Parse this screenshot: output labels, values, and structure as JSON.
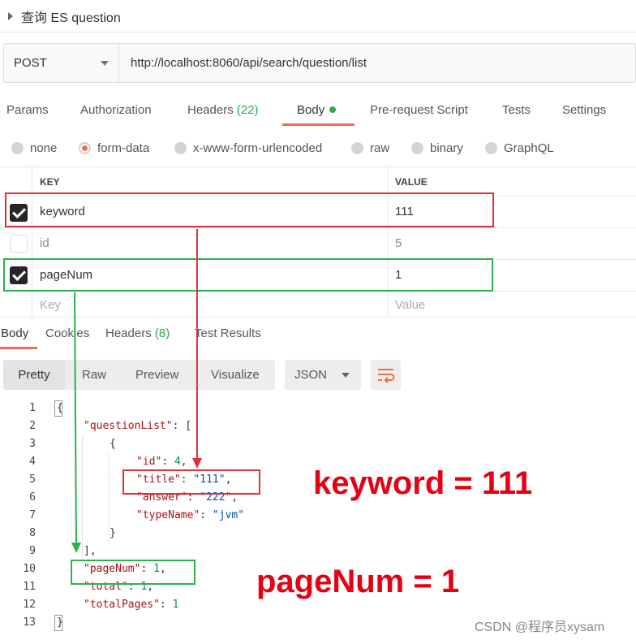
{
  "request": {
    "title": "查询 ES question",
    "method": "POST",
    "url": "http://localhost:8060/api/search/question/list"
  },
  "request_tabs": {
    "params": "Params",
    "authorization": "Authorization",
    "headers": "Headers",
    "headers_count": "(22)",
    "body": "Body",
    "prerequest": "Pre-request Script",
    "tests": "Tests",
    "settings": "Settings"
  },
  "body_types": {
    "none": "none",
    "form_data": "form-data",
    "urlencoded": "x-www-form-urlencoded",
    "raw": "raw",
    "binary": "binary",
    "graphql": "GraphQL"
  },
  "params_table": {
    "key_header": "KEY",
    "value_header": "VALUE",
    "rows": [
      {
        "key": "keyword",
        "value": "111",
        "checked": true
      },
      {
        "key": "id",
        "value": "5",
        "checked": false
      },
      {
        "key": "pageNum",
        "value": "1",
        "checked": true
      }
    ],
    "placeholder_key": "Key",
    "placeholder_value": "Value"
  },
  "response_tabs": {
    "body": "Body",
    "cookies": "Cookies",
    "headers": "Headers",
    "headers_count": "(8)",
    "test_results": "Test Results"
  },
  "response_toolbar": {
    "pretty": "Pretty",
    "raw": "Raw",
    "preview": "Preview",
    "visualize": "Visualize",
    "format": "JSON"
  },
  "code_lines": [
    "1",
    "2",
    "3",
    "4",
    "5",
    "6",
    "7",
    "8",
    "9",
    "10",
    "11",
    "12",
    "13"
  ],
  "json": {
    "k_questionList": "\"questionList\"",
    "k_id": "\"id\"",
    "v_id": "4",
    "k_title": "\"title\"",
    "v_title": "\"111\"",
    "k_answer": "\"answer\"",
    "v_answer": "\"222\"",
    "k_typeName": "\"typeName\"",
    "v_typeName": "\"jvm\"",
    "k_pageNum": "\"pageNum\"",
    "v_pageNum": "1",
    "k_total": "\"total\"",
    "v_total": "1",
    "k_totalPages": "\"totalPages\"",
    "v_totalPages": "1"
  },
  "annotations": {
    "keyword_label": "keyword = 111",
    "pagenum_label": "pageNum = 1",
    "red": "#e0303a",
    "green": "#2bb24c"
  },
  "watermark": "CSDN @程序员xysam",
  "colors": {
    "accent": "#e8704b",
    "green": "#2fa84f"
  }
}
